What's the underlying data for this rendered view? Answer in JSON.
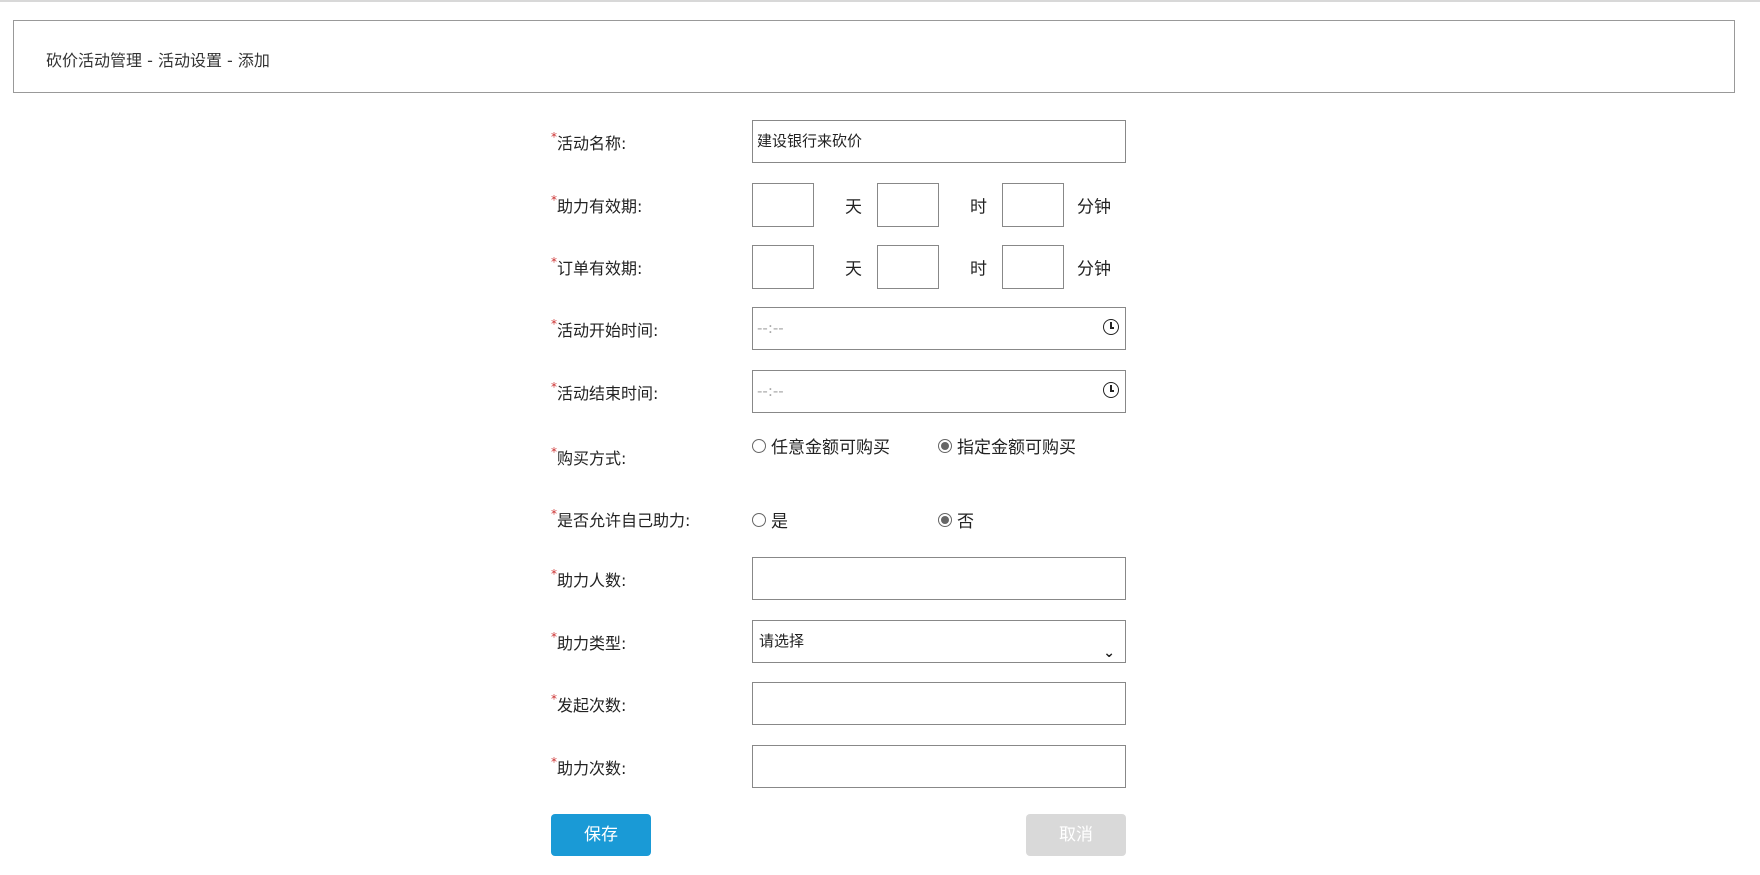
{
  "breadcrumb": "砍价活动管理 - 活动设置 - 添加",
  "form": {
    "activity_name": {
      "label": "活动名称:",
      "value": "建设银行来砍价"
    },
    "assist_validity": {
      "label": "助力有效期:",
      "units": [
        "天",
        "时",
        "分钟"
      ]
    },
    "order_validity": {
      "label": "订单有效期:",
      "units": [
        "天",
        "时",
        "分钟"
      ]
    },
    "start_time": {
      "label": "活动开始时间:",
      "placeholder": "--:--"
    },
    "end_time": {
      "label": "活动结束时间:",
      "placeholder": "--:--"
    },
    "purchase_mode": {
      "label": "购买方式:",
      "options": [
        "任意金额可购买",
        "指定金额可购买"
      ],
      "selected": 1
    },
    "self_assist": {
      "label": "是否允许自己助力:",
      "options": [
        "是",
        "否"
      ],
      "selected": 1
    },
    "assist_count": {
      "label": "助力人数:"
    },
    "assist_type": {
      "label": "助力类型:",
      "value": "请选择"
    },
    "launch_times": {
      "label": "发起次数:"
    },
    "assist_times": {
      "label": "助力次数:"
    }
  },
  "buttons": {
    "save": "保存",
    "cancel": "取消"
  },
  "colors": {
    "save": "#1a9ad6",
    "cancel": "#d9d9d9",
    "required": "#cc3333"
  }
}
